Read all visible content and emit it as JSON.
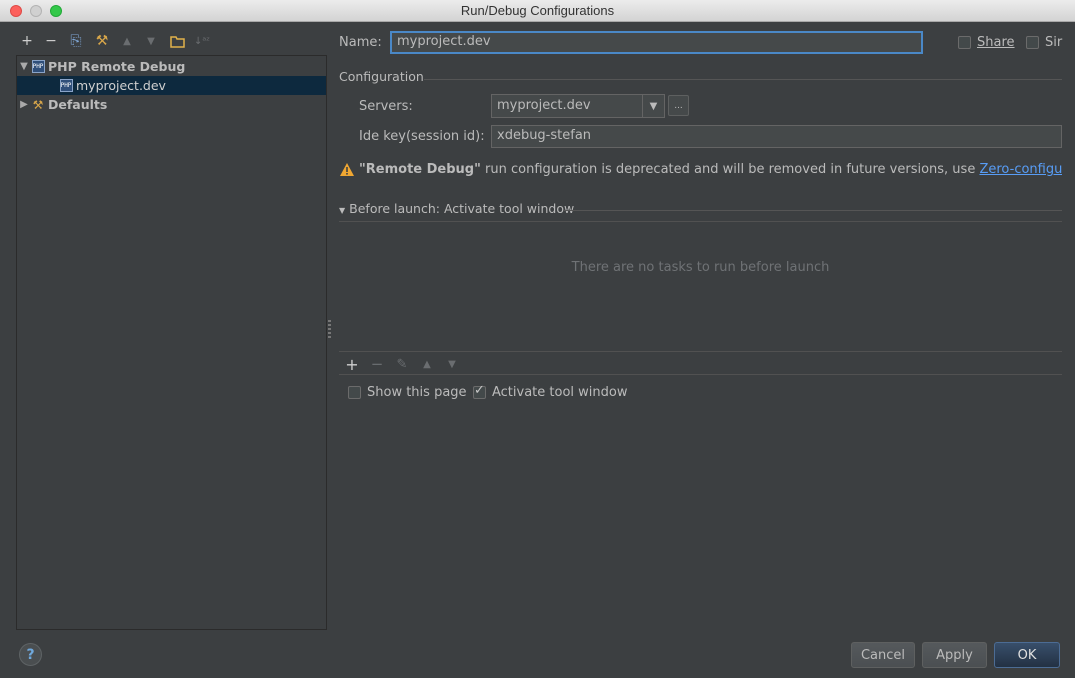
{
  "window": {
    "title": "Run/Debug Configurations"
  },
  "left_toolbar": {
    "buttons": [
      {
        "icon": "plus-icon",
        "glyph": "+"
      },
      {
        "icon": "minus-icon",
        "glyph": "−"
      },
      {
        "icon": "copy-icon",
        "glyph": "⎘"
      },
      {
        "icon": "wrench-icon",
        "glyph": "⚒"
      },
      {
        "icon": "move-up-icon",
        "glyph": "▲"
      },
      {
        "icon": "move-down-icon",
        "glyph": "▼"
      },
      {
        "icon": "folder-icon",
        "glyph": "▭"
      },
      {
        "icon": "sort-icon",
        "glyph": "↓ᵃᶻ"
      }
    ]
  },
  "tree": {
    "group": "PHP Remote Debug",
    "item": "myproject.dev",
    "defaults": "Defaults",
    "php_icon_text": "PHP"
  },
  "form": {
    "name_label": "Name:",
    "name_value": "myproject.dev",
    "share_label": "Share",
    "single_label": "Sir",
    "configuration_label": "Configuration",
    "servers_label": "Servers:",
    "servers_value": "myproject.dev",
    "dots": "...",
    "ide_key_label": "Ide key(session id):",
    "ide_key_value": "xdebug-stefan",
    "warning_bold": "\"Remote Debug\"",
    "warning_text": " run configuration is deprecated and will be removed in future versions, use ",
    "warning_link": "Zero-configuration"
  },
  "before_launch": {
    "header": "Before launch: Activate tool window",
    "empty": "There are no tasks to run before launch",
    "show_page_label": "Show this page",
    "show_page_checked": false,
    "activate_label": "Activate tool window",
    "activate_checked": true
  },
  "buttons": {
    "help": "?",
    "cancel": "Cancel",
    "apply": "Apply",
    "ok": "OK"
  },
  "colors": {
    "background": "#3c3f41",
    "selection": "#0d293e",
    "focus": "#4a88c7",
    "link": "#589df6",
    "warning": "#f0a732"
  }
}
